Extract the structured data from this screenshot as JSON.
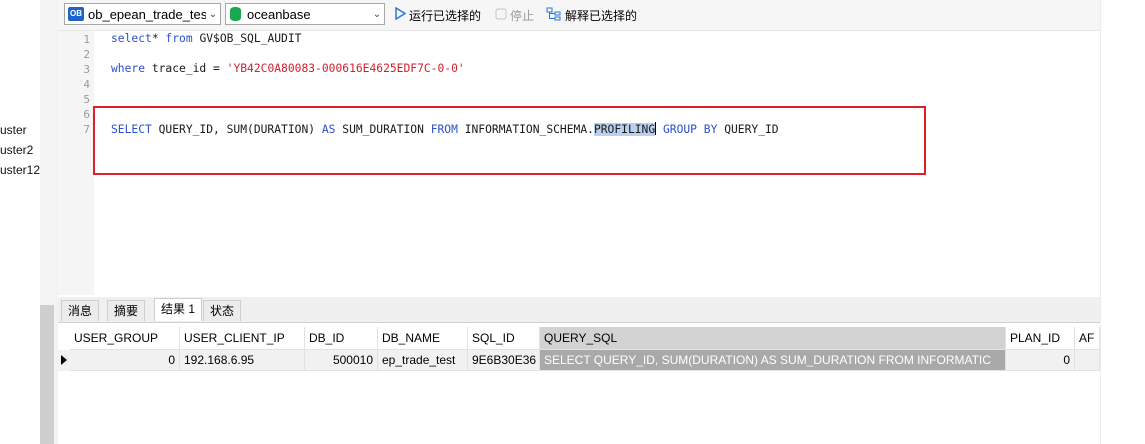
{
  "sidebar": {
    "items": [
      "uster",
      "uster2",
      "uster12"
    ]
  },
  "toolbar": {
    "connection": {
      "badge": "OB",
      "value": "ob_epean_trade_tes"
    },
    "database": {
      "value": "oceanbase"
    },
    "run_selected": "运行已选择的",
    "stop": "停止",
    "explain_selected": "解释已选择的"
  },
  "editor": {
    "line_numbers": [
      "1",
      "2",
      "3",
      "4",
      "5",
      "6",
      "7"
    ],
    "line1": {
      "kw1": "select",
      "rest": "* ",
      "kw2": "from",
      "tail": " GV$OB_SQL_AUDIT"
    },
    "line3": {
      "kw1": "where",
      "mid": " trace_id = ",
      "str": "'YB42C0A80083-000616E4625EDF7C-0-0'"
    },
    "line7": {
      "kw_select": "SELECT",
      "t1": " QUERY_ID, SUM(DURATION) ",
      "kw_as": "AS",
      "t2": " SUM_DURATION ",
      "kw_from": "FROM",
      "t3": " INFORMATION_SCHEMA.",
      "highlight": "PROFILING",
      "kw_group": "GROUP BY",
      "t4": " QUERY_ID"
    }
  },
  "tabs": [
    "消息",
    "摘要",
    "结果 1",
    "状态"
  ],
  "active_tab": "结果 1",
  "grid": {
    "columns": [
      "USER_GROUP",
      "USER_CLIENT_IP",
      "DB_ID",
      "DB_NAME",
      "SQL_ID",
      "QUERY_SQL",
      "PLAN_ID",
      "AF"
    ],
    "rows": [
      [
        "0",
        "192.168.6.95",
        "500010",
        "ep_trade_test",
        "9E6B30E36",
        "SELECT QUERY_ID, SUM(DURATION) AS SUM_DURATION FROM INFORMATIC",
        "0",
        ""
      ]
    ]
  },
  "colors": {
    "highlight_box": "#e01f26",
    "keyword": "#2c4fcf",
    "string": "#d0202c",
    "selection": "#b9d0ee"
  }
}
